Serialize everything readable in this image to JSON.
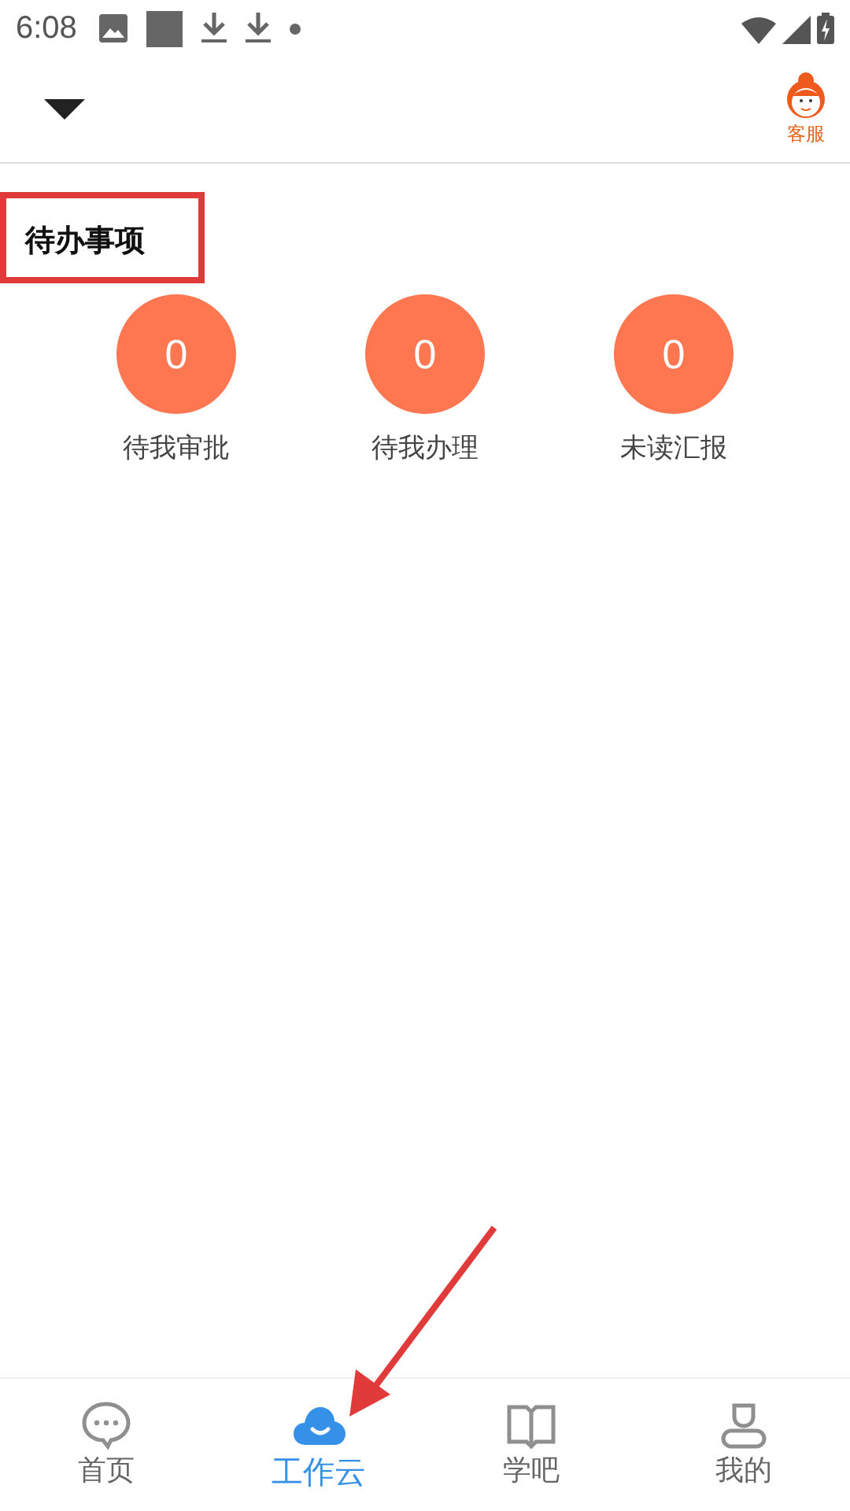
{
  "status_bar": {
    "time": "6:08"
  },
  "header": {
    "support_label": "客服"
  },
  "section": {
    "title": "待办事项",
    "highlighted": true,
    "items": [
      {
        "count": "0",
        "label": "待我审批"
      },
      {
        "count": "0",
        "label": "待我办理"
      },
      {
        "count": "0",
        "label": "未读汇报"
      }
    ]
  },
  "tabs": [
    {
      "kind": "chat",
      "label": "首页",
      "selected": false,
      "pointed_at": false
    },
    {
      "kind": "cloud",
      "label": "工作云",
      "selected": true,
      "pointed_at": true
    },
    {
      "kind": "book",
      "label": "学吧",
      "selected": false,
      "pointed_at": false
    },
    {
      "kind": "person",
      "label": "我的",
      "selected": false,
      "pointed_at": false
    }
  ]
}
